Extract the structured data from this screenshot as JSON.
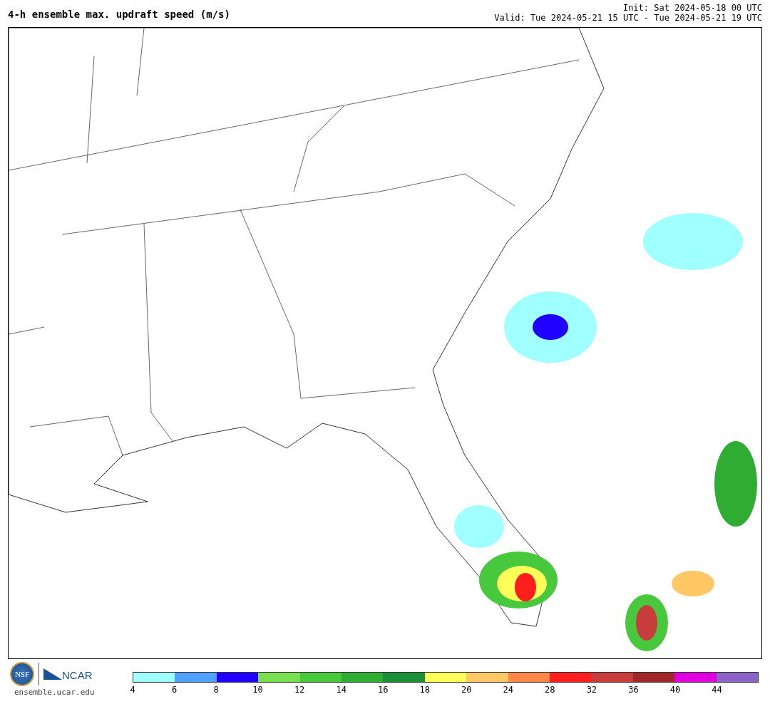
{
  "title": "4-h ensemble max. updraft speed (m/s)",
  "init": "Init: Sat 2024-05-18 00 UTC",
  "valid": "Valid: Tue 2024-05-21 15 UTC - Tue 2024-05-21 19 UTC",
  "logos": {
    "nsf": "NSF",
    "ncar": "NCAR",
    "url": "ensemble.ucar.edu"
  },
  "colorbar": {
    "segments": [
      {
        "color": "#a0ffff"
      },
      {
        "color": "#50a0ff"
      },
      {
        "color": "#2000ff"
      },
      {
        "color": "#78e050"
      },
      {
        "color": "#48c83c"
      },
      {
        "color": "#2ead32"
      },
      {
        "color": "#1a9039"
      },
      {
        "color": "#ffff5a"
      },
      {
        "color": "#ffc864"
      },
      {
        "color": "#ff8848"
      },
      {
        "color": "#ff1e1e"
      },
      {
        "color": "#c83c3c"
      },
      {
        "color": "#a02828"
      },
      {
        "color": "#e000e0"
      },
      {
        "color": "#8c64c8"
      }
    ],
    "ticks": [
      "4",
      "6",
      "8",
      "10",
      "12",
      "14",
      "16",
      "18",
      "20",
      "24",
      "28",
      "32",
      "36",
      "40",
      "44"
    ]
  }
}
